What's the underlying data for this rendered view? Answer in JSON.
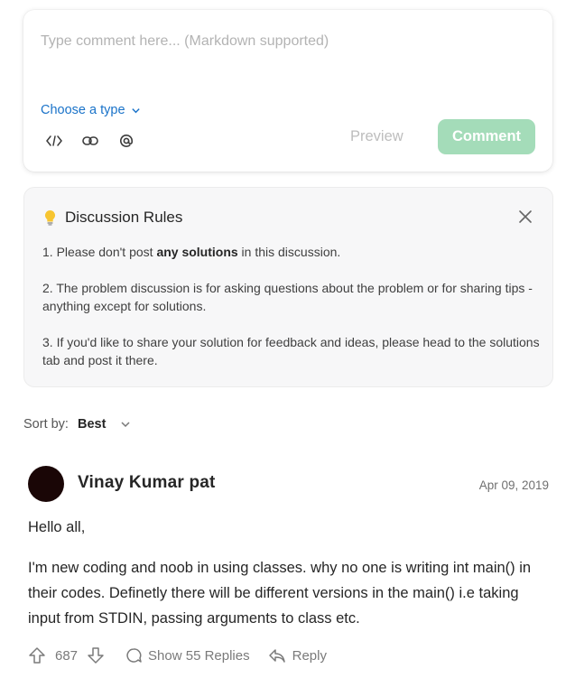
{
  "composer": {
    "placeholder": "Type comment here... (Markdown supported)",
    "type_select": "Choose a type",
    "tools": [
      "code-icon",
      "link-icon",
      "mention-icon"
    ],
    "preview_label": "Preview",
    "comment_label": "Comment"
  },
  "rules": {
    "title": "Discussion Rules",
    "items": [
      {
        "prefix": "1. Please don't post ",
        "bold": "any solutions",
        "suffix": " in this discussion."
      },
      {
        "text": "2. The problem discussion is for asking questions about the problem or for sharing tips - anything except for solutions."
      },
      {
        "text": "3. If you'd like to share your solution for feedback and ideas, please head to the solutions tab and post it there."
      }
    ]
  },
  "sort": {
    "label": "Sort by:",
    "value": "Best"
  },
  "post": {
    "author": "Vinay Kumar pat",
    "date": "Apr 09, 2019",
    "paragraphs": [
      "Hello all,",
      "I'm new coding and noob in using classes. why no one is writing int main() in their codes. Definetly there will be different versions in the main() i.e taking input from STDIN, passing arguments to class etc."
    ],
    "votes": "687",
    "show_replies": "Show 55 Replies",
    "reply": "Reply"
  },
  "colors": {
    "accent": "#1a73c9",
    "comment_button": "#a4dcb9",
    "rules_bg": "#f7f7f8"
  }
}
